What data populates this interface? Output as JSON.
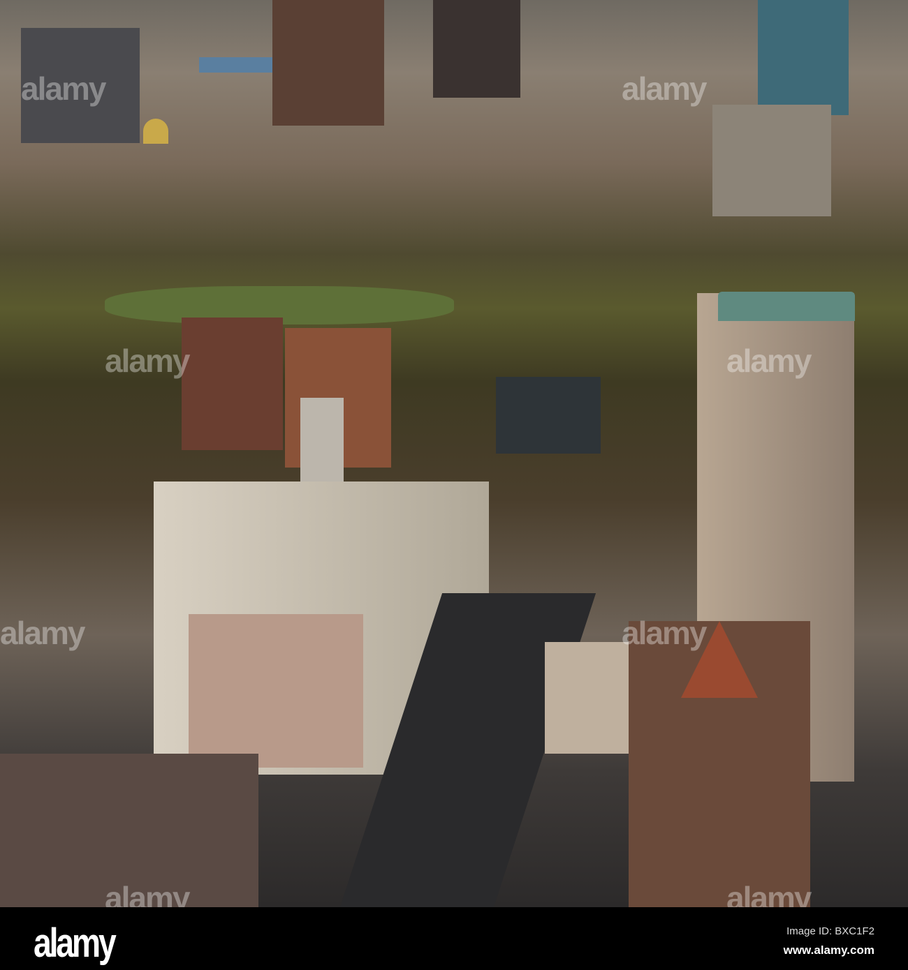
{
  "photo": {
    "subject": "aerial-city-view"
  },
  "watermark": {
    "text": "alamy"
  },
  "footer": {
    "logo": "alamy",
    "image_id": "Image ID: BXC1F2",
    "url": "www.alamy.com"
  }
}
